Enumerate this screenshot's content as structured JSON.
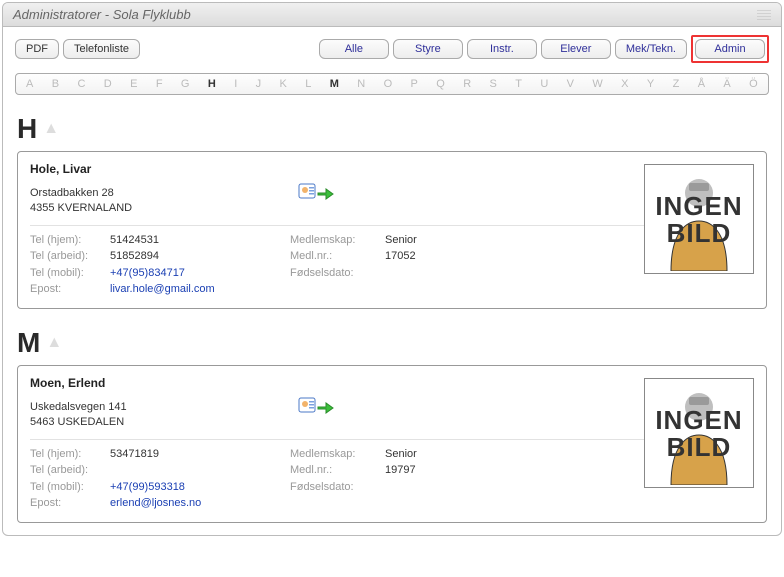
{
  "window": {
    "title": "Administratorer - Sola Flyklubb"
  },
  "toolbar": {
    "pdf": "PDF",
    "telefonliste": "Telefonliste",
    "filters": {
      "alle": "Alle",
      "styre": "Styre",
      "instr": "Instr.",
      "elever": "Elever",
      "mektekn": "Mek/Tekn.",
      "admin": "Admin"
    }
  },
  "alphabet": [
    "A",
    "B",
    "C",
    "D",
    "E",
    "F",
    "G",
    "H",
    "I",
    "J",
    "K",
    "L",
    "M",
    "N",
    "O",
    "P",
    "Q",
    "R",
    "S",
    "T",
    "U",
    "V",
    "W",
    "X",
    "Y",
    "Z",
    "Å",
    "Ä",
    "Ö"
  ],
  "alphabet_active": [
    "H",
    "M"
  ],
  "sections": [
    {
      "letter": "H",
      "card": {
        "name": "Hole, Livar",
        "address_line1": "Orstadbakken 28",
        "address_line2": "4355 KVERNALAND",
        "tel_hjem_label": "Tel (hjem):",
        "tel_hjem": "51424531",
        "tel_arbeid_label": "Tel (arbeid):",
        "tel_arbeid": "51852894",
        "tel_mobil_label": "Tel (mobil):",
        "tel_mobil": "+47(95)834717",
        "epost_label": "Epost:",
        "epost": "livar.hole@gmail.com",
        "medlemskap_label": "Medlemskap:",
        "medlemskap": "Senior",
        "medlnr_label": "Medl.nr.:",
        "medlnr": "17052",
        "fodselsdato_label": "Fødselsdato:",
        "fodselsdato": "",
        "photo_line1": "INGEN",
        "photo_line2": "BILD"
      }
    },
    {
      "letter": "M",
      "card": {
        "name": "Moen, Erlend",
        "address_line1": "Uskedalsvegen 141",
        "address_line2": "5463 USKEDALEN",
        "tel_hjem_label": "Tel (hjem):",
        "tel_hjem": "53471819",
        "tel_arbeid_label": "Tel (arbeid):",
        "tel_arbeid": "",
        "tel_mobil_label": "Tel (mobil):",
        "tel_mobil": "+47(99)593318",
        "epost_label": "Epost:",
        "epost": "erlend@ljosnes.no",
        "medlemskap_label": "Medlemskap:",
        "medlemskap": "Senior",
        "medlnr_label": "Medl.nr.:",
        "medlnr": "19797",
        "fodselsdato_label": "Fødselsdato:",
        "fodselsdato": "",
        "photo_line1": "INGEN",
        "photo_line2": "BILD"
      }
    }
  ]
}
